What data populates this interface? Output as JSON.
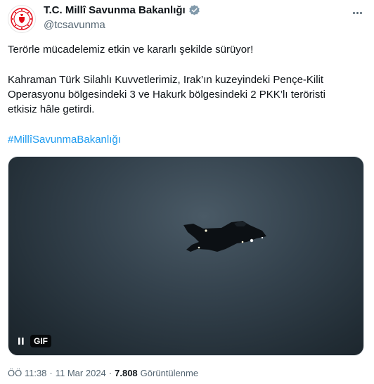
{
  "account": {
    "display_name": "T.C. Millî Savunma Bakanlığı",
    "handle": "@tcsavunma",
    "verified_badge_color": "#829aab",
    "avatar_icon": "ministry-emblem-icon",
    "avatar_color": "#e30a17"
  },
  "tweet": {
    "paragraph1": "Terörle mücadelemiz etkin ve kararlı şekilde sürüyor!",
    "paragraph2_line1": "Kahraman Türk Silahlı Kuvvetlerimiz, Irak’ın kuzeyindeki Pençe-Kilit",
    "paragraph2_line2": "Operasyonu bölgesindeki 3 ve Hakurk bölgesindeki  2 PKK’lı teröristi",
    "paragraph2_line3": "etkisiz hâle getirdi.",
    "hashtag": "#MillîSavunmaBakanlığı",
    "hashtag_color": "#1d9bf0"
  },
  "media": {
    "type": "gif",
    "badge_label": "GIF",
    "control_icon": "pause-icon",
    "subject_icon": "fighter-jet-icon"
  },
  "meta": {
    "time": "ÖÖ 11:38",
    "separator": "·",
    "date": "11 Mar 2024",
    "views_count": "7.808",
    "views_label": "Görüntülenme"
  }
}
